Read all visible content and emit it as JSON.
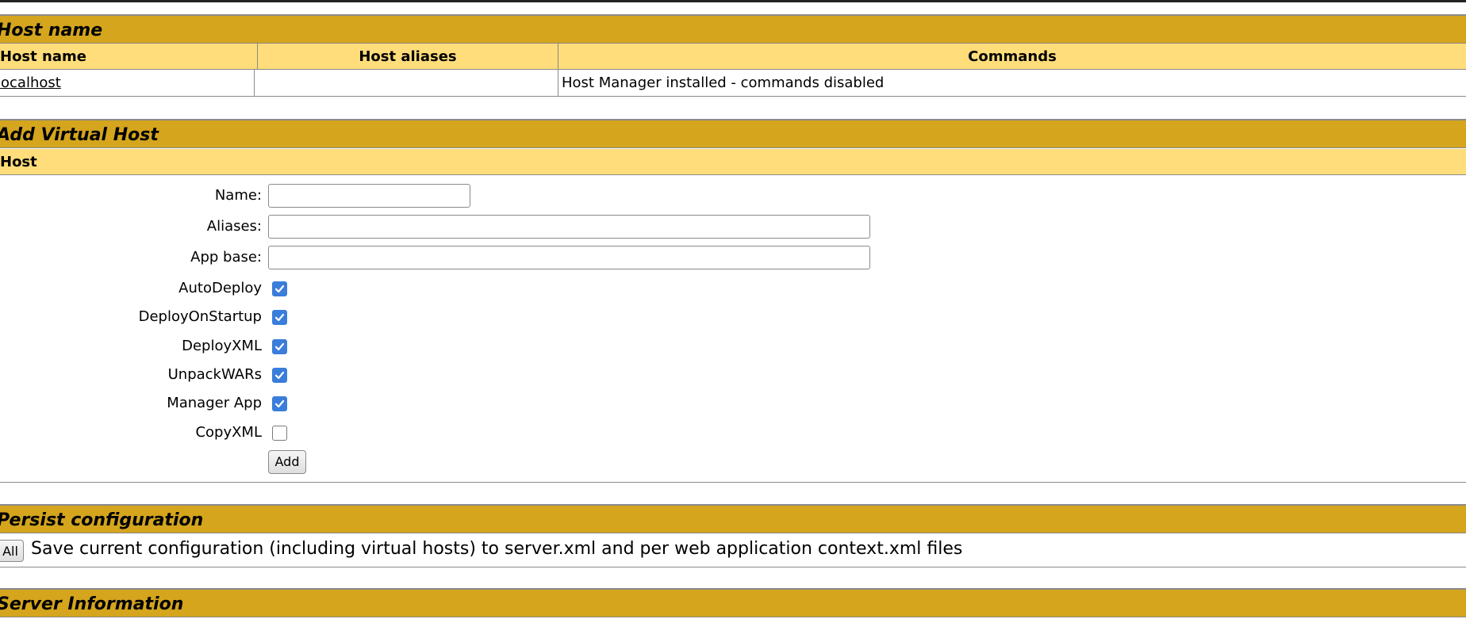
{
  "host_section": {
    "title": "Host name",
    "columns": [
      "Host name",
      "Host aliases",
      "Commands"
    ],
    "rows": [
      {
        "host_name": "localhost",
        "aliases": "",
        "commands": "Host Manager installed - commands disabled"
      }
    ]
  },
  "add_section": {
    "title": "Add Virtual Host",
    "subheader": "Host",
    "fields": {
      "name_label": "Name:",
      "name_value": "",
      "aliases_label": "Aliases:",
      "aliases_value": "",
      "appbase_label": "App base:",
      "appbase_value": ""
    },
    "checkboxes": [
      {
        "label": "AutoDeploy",
        "checked": true
      },
      {
        "label": "DeployOnStartup",
        "checked": true
      },
      {
        "label": "DeployXML",
        "checked": true
      },
      {
        "label": "UnpackWARs",
        "checked": true
      },
      {
        "label": "Manager App",
        "checked": true
      },
      {
        "label": "CopyXML",
        "checked": false
      }
    ],
    "add_button": "Add"
  },
  "persist_section": {
    "title": "Persist configuration",
    "button": "All",
    "description": "Save current configuration (including virtual hosts) to server.xml and per web application context.xml files"
  },
  "server_section": {
    "title": "Server Information"
  },
  "colors": {
    "section_bg": "#d4a51d",
    "subheader_bg": "#ffdd7a",
    "checkbox_on": "#3a7ddb"
  }
}
